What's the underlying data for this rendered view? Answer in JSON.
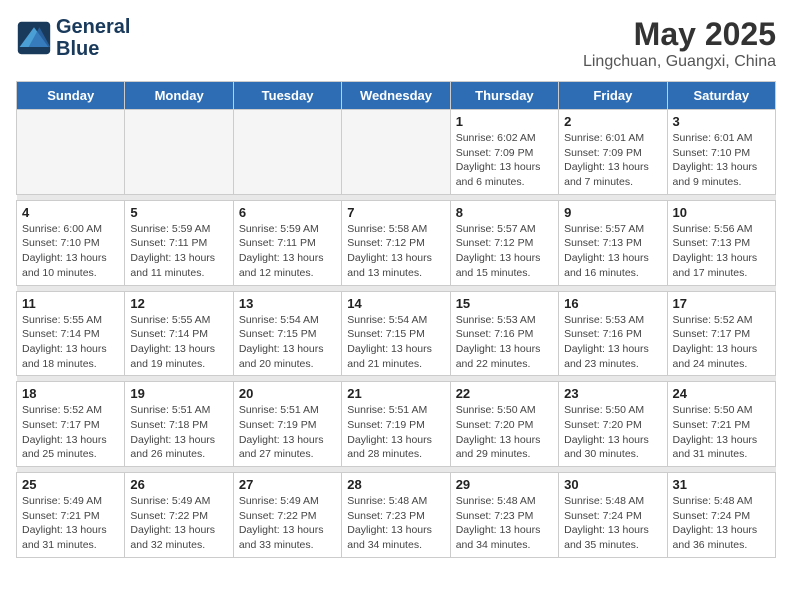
{
  "header": {
    "logo_line1": "General",
    "logo_line2": "Blue",
    "month_year": "May 2025",
    "location": "Lingchuan, Guangxi, China"
  },
  "weekdays": [
    "Sunday",
    "Monday",
    "Tuesday",
    "Wednesday",
    "Thursday",
    "Friday",
    "Saturday"
  ],
  "weeks": [
    [
      {
        "day": "",
        "info": ""
      },
      {
        "day": "",
        "info": ""
      },
      {
        "day": "",
        "info": ""
      },
      {
        "day": "",
        "info": ""
      },
      {
        "day": "1",
        "info": "Sunrise: 6:02 AM\nSunset: 7:09 PM\nDaylight: 13 hours\nand 6 minutes."
      },
      {
        "day": "2",
        "info": "Sunrise: 6:01 AM\nSunset: 7:09 PM\nDaylight: 13 hours\nand 7 minutes."
      },
      {
        "day": "3",
        "info": "Sunrise: 6:01 AM\nSunset: 7:10 PM\nDaylight: 13 hours\nand 9 minutes."
      }
    ],
    [
      {
        "day": "4",
        "info": "Sunrise: 6:00 AM\nSunset: 7:10 PM\nDaylight: 13 hours\nand 10 minutes."
      },
      {
        "day": "5",
        "info": "Sunrise: 5:59 AM\nSunset: 7:11 PM\nDaylight: 13 hours\nand 11 minutes."
      },
      {
        "day": "6",
        "info": "Sunrise: 5:59 AM\nSunset: 7:11 PM\nDaylight: 13 hours\nand 12 minutes."
      },
      {
        "day": "7",
        "info": "Sunrise: 5:58 AM\nSunset: 7:12 PM\nDaylight: 13 hours\nand 13 minutes."
      },
      {
        "day": "8",
        "info": "Sunrise: 5:57 AM\nSunset: 7:12 PM\nDaylight: 13 hours\nand 15 minutes."
      },
      {
        "day": "9",
        "info": "Sunrise: 5:57 AM\nSunset: 7:13 PM\nDaylight: 13 hours\nand 16 minutes."
      },
      {
        "day": "10",
        "info": "Sunrise: 5:56 AM\nSunset: 7:13 PM\nDaylight: 13 hours\nand 17 minutes."
      }
    ],
    [
      {
        "day": "11",
        "info": "Sunrise: 5:55 AM\nSunset: 7:14 PM\nDaylight: 13 hours\nand 18 minutes."
      },
      {
        "day": "12",
        "info": "Sunrise: 5:55 AM\nSunset: 7:14 PM\nDaylight: 13 hours\nand 19 minutes."
      },
      {
        "day": "13",
        "info": "Sunrise: 5:54 AM\nSunset: 7:15 PM\nDaylight: 13 hours\nand 20 minutes."
      },
      {
        "day": "14",
        "info": "Sunrise: 5:54 AM\nSunset: 7:15 PM\nDaylight: 13 hours\nand 21 minutes."
      },
      {
        "day": "15",
        "info": "Sunrise: 5:53 AM\nSunset: 7:16 PM\nDaylight: 13 hours\nand 22 minutes."
      },
      {
        "day": "16",
        "info": "Sunrise: 5:53 AM\nSunset: 7:16 PM\nDaylight: 13 hours\nand 23 minutes."
      },
      {
        "day": "17",
        "info": "Sunrise: 5:52 AM\nSunset: 7:17 PM\nDaylight: 13 hours\nand 24 minutes."
      }
    ],
    [
      {
        "day": "18",
        "info": "Sunrise: 5:52 AM\nSunset: 7:17 PM\nDaylight: 13 hours\nand 25 minutes."
      },
      {
        "day": "19",
        "info": "Sunrise: 5:51 AM\nSunset: 7:18 PM\nDaylight: 13 hours\nand 26 minutes."
      },
      {
        "day": "20",
        "info": "Sunrise: 5:51 AM\nSunset: 7:19 PM\nDaylight: 13 hours\nand 27 minutes."
      },
      {
        "day": "21",
        "info": "Sunrise: 5:51 AM\nSunset: 7:19 PM\nDaylight: 13 hours\nand 28 minutes."
      },
      {
        "day": "22",
        "info": "Sunrise: 5:50 AM\nSunset: 7:20 PM\nDaylight: 13 hours\nand 29 minutes."
      },
      {
        "day": "23",
        "info": "Sunrise: 5:50 AM\nSunset: 7:20 PM\nDaylight: 13 hours\nand 30 minutes."
      },
      {
        "day": "24",
        "info": "Sunrise: 5:50 AM\nSunset: 7:21 PM\nDaylight: 13 hours\nand 31 minutes."
      }
    ],
    [
      {
        "day": "25",
        "info": "Sunrise: 5:49 AM\nSunset: 7:21 PM\nDaylight: 13 hours\nand 31 minutes."
      },
      {
        "day": "26",
        "info": "Sunrise: 5:49 AM\nSunset: 7:22 PM\nDaylight: 13 hours\nand 32 minutes."
      },
      {
        "day": "27",
        "info": "Sunrise: 5:49 AM\nSunset: 7:22 PM\nDaylight: 13 hours\nand 33 minutes."
      },
      {
        "day": "28",
        "info": "Sunrise: 5:48 AM\nSunset: 7:23 PM\nDaylight: 13 hours\nand 34 minutes."
      },
      {
        "day": "29",
        "info": "Sunrise: 5:48 AM\nSunset: 7:23 PM\nDaylight: 13 hours\nand 34 minutes."
      },
      {
        "day": "30",
        "info": "Sunrise: 5:48 AM\nSunset: 7:24 PM\nDaylight: 13 hours\nand 35 minutes."
      },
      {
        "day": "31",
        "info": "Sunrise: 5:48 AM\nSunset: 7:24 PM\nDaylight: 13 hours\nand 36 minutes."
      }
    ]
  ]
}
